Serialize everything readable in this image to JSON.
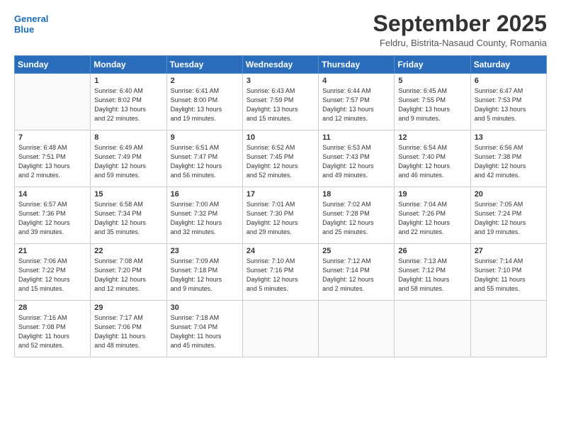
{
  "header": {
    "logo_line1": "General",
    "logo_line2": "Blue",
    "month": "September 2025",
    "location": "Feldru, Bistrita-Nasaud County, Romania"
  },
  "days_of_week": [
    "Sunday",
    "Monday",
    "Tuesday",
    "Wednesday",
    "Thursday",
    "Friday",
    "Saturday"
  ],
  "weeks": [
    [
      {
        "day": "",
        "info": ""
      },
      {
        "day": "1",
        "info": "Sunrise: 6:40 AM\nSunset: 8:02 PM\nDaylight: 13 hours\nand 22 minutes."
      },
      {
        "day": "2",
        "info": "Sunrise: 6:41 AM\nSunset: 8:00 PM\nDaylight: 13 hours\nand 19 minutes."
      },
      {
        "day": "3",
        "info": "Sunrise: 6:43 AM\nSunset: 7:59 PM\nDaylight: 13 hours\nand 15 minutes."
      },
      {
        "day": "4",
        "info": "Sunrise: 6:44 AM\nSunset: 7:57 PM\nDaylight: 13 hours\nand 12 minutes."
      },
      {
        "day": "5",
        "info": "Sunrise: 6:45 AM\nSunset: 7:55 PM\nDaylight: 13 hours\nand 9 minutes."
      },
      {
        "day": "6",
        "info": "Sunrise: 6:47 AM\nSunset: 7:53 PM\nDaylight: 13 hours\nand 5 minutes."
      }
    ],
    [
      {
        "day": "7",
        "info": "Sunrise: 6:48 AM\nSunset: 7:51 PM\nDaylight: 13 hours\nand 2 minutes."
      },
      {
        "day": "8",
        "info": "Sunrise: 6:49 AM\nSunset: 7:49 PM\nDaylight: 12 hours\nand 59 minutes."
      },
      {
        "day": "9",
        "info": "Sunrise: 6:51 AM\nSunset: 7:47 PM\nDaylight: 12 hours\nand 56 minutes."
      },
      {
        "day": "10",
        "info": "Sunrise: 6:52 AM\nSunset: 7:45 PM\nDaylight: 12 hours\nand 52 minutes."
      },
      {
        "day": "11",
        "info": "Sunrise: 6:53 AM\nSunset: 7:43 PM\nDaylight: 12 hours\nand 49 minutes."
      },
      {
        "day": "12",
        "info": "Sunrise: 6:54 AM\nSunset: 7:40 PM\nDaylight: 12 hours\nand 46 minutes."
      },
      {
        "day": "13",
        "info": "Sunrise: 6:56 AM\nSunset: 7:38 PM\nDaylight: 12 hours\nand 42 minutes."
      }
    ],
    [
      {
        "day": "14",
        "info": "Sunrise: 6:57 AM\nSunset: 7:36 PM\nDaylight: 12 hours\nand 39 minutes."
      },
      {
        "day": "15",
        "info": "Sunrise: 6:58 AM\nSunset: 7:34 PM\nDaylight: 12 hours\nand 35 minutes."
      },
      {
        "day": "16",
        "info": "Sunrise: 7:00 AM\nSunset: 7:32 PM\nDaylight: 12 hours\nand 32 minutes."
      },
      {
        "day": "17",
        "info": "Sunrise: 7:01 AM\nSunset: 7:30 PM\nDaylight: 12 hours\nand 29 minutes."
      },
      {
        "day": "18",
        "info": "Sunrise: 7:02 AM\nSunset: 7:28 PM\nDaylight: 12 hours\nand 25 minutes."
      },
      {
        "day": "19",
        "info": "Sunrise: 7:04 AM\nSunset: 7:26 PM\nDaylight: 12 hours\nand 22 minutes."
      },
      {
        "day": "20",
        "info": "Sunrise: 7:05 AM\nSunset: 7:24 PM\nDaylight: 12 hours\nand 19 minutes."
      }
    ],
    [
      {
        "day": "21",
        "info": "Sunrise: 7:06 AM\nSunset: 7:22 PM\nDaylight: 12 hours\nand 15 minutes."
      },
      {
        "day": "22",
        "info": "Sunrise: 7:08 AM\nSunset: 7:20 PM\nDaylight: 12 hours\nand 12 minutes."
      },
      {
        "day": "23",
        "info": "Sunrise: 7:09 AM\nSunset: 7:18 PM\nDaylight: 12 hours\nand 9 minutes."
      },
      {
        "day": "24",
        "info": "Sunrise: 7:10 AM\nSunset: 7:16 PM\nDaylight: 12 hours\nand 5 minutes."
      },
      {
        "day": "25",
        "info": "Sunrise: 7:12 AM\nSunset: 7:14 PM\nDaylight: 12 hours\nand 2 minutes."
      },
      {
        "day": "26",
        "info": "Sunrise: 7:13 AM\nSunset: 7:12 PM\nDaylight: 11 hours\nand 58 minutes."
      },
      {
        "day": "27",
        "info": "Sunrise: 7:14 AM\nSunset: 7:10 PM\nDaylight: 11 hours\nand 55 minutes."
      }
    ],
    [
      {
        "day": "28",
        "info": "Sunrise: 7:16 AM\nSunset: 7:08 PM\nDaylight: 11 hours\nand 52 minutes."
      },
      {
        "day": "29",
        "info": "Sunrise: 7:17 AM\nSunset: 7:06 PM\nDaylight: 11 hours\nand 48 minutes."
      },
      {
        "day": "30",
        "info": "Sunrise: 7:18 AM\nSunset: 7:04 PM\nDaylight: 11 hours\nand 45 minutes."
      },
      {
        "day": "",
        "info": ""
      },
      {
        "day": "",
        "info": ""
      },
      {
        "day": "",
        "info": ""
      },
      {
        "day": "",
        "info": ""
      }
    ]
  ]
}
